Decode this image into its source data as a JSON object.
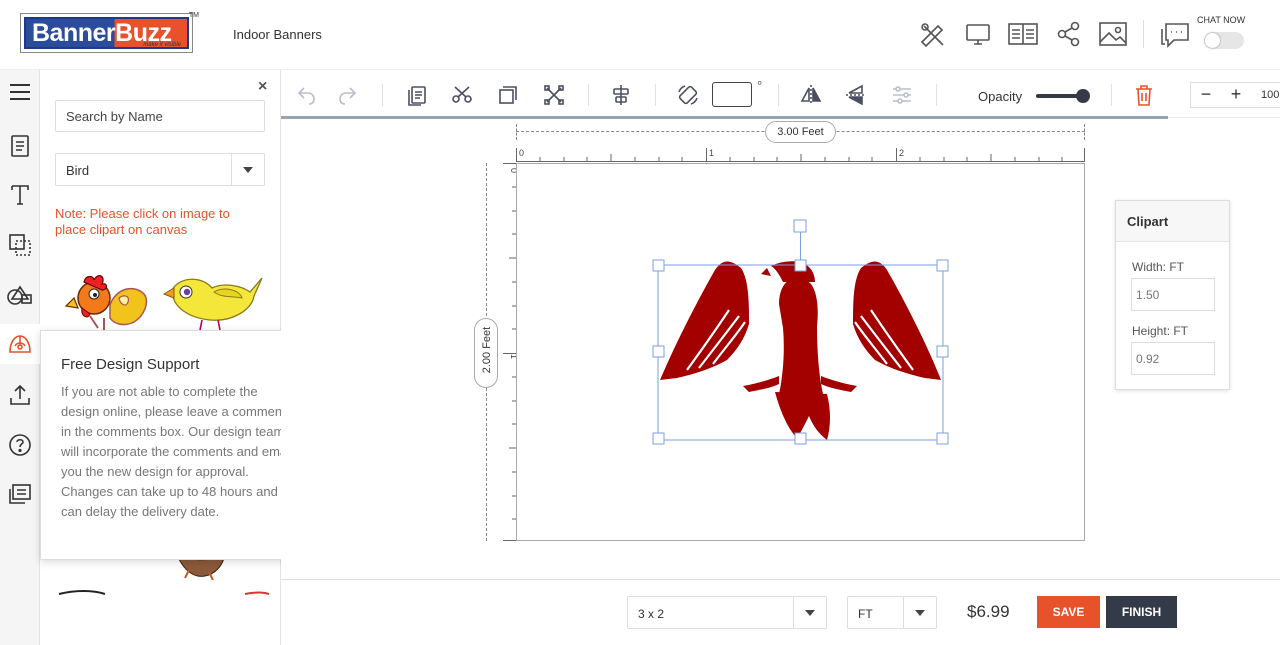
{
  "header": {
    "logo_text_a": "Banner",
    "logo_text_b": "Buzz",
    "logo_tagline": "make it visible",
    "logo_tm": "TM",
    "product_name": "Indoor Banners",
    "chat_label": "CHAT NOW",
    "icons": [
      "tools-icon",
      "desktop-preview-icon",
      "book-guide-icon",
      "share-icon",
      "image-icon",
      "chat-icon"
    ]
  },
  "leftbar": {
    "items": [
      "menu-icon",
      "templates-icon",
      "text-icon",
      "layers-icon",
      "shapes-icon",
      "clipart-icon",
      "upload-icon",
      "help-icon",
      "comments-icon"
    ],
    "active_index": 5
  },
  "panel": {
    "search_placeholder": "Search by Name",
    "category_selected": "Bird",
    "note": "Note: Please click on image to place clipart on canvas",
    "close_glyph": "×"
  },
  "tooltip": {
    "title": "Free Design Support",
    "body": "If you are not able to complete the design online, please leave a comments in the comments box. Our design team will incorporate the comments and email you the new design for approval. Changes can take up to 48 hours and can delay the delivery date.",
    "close_glyph": "×"
  },
  "toolbar": {
    "angle_value": "",
    "degree_symbol": "°",
    "opacity_label": "Opacity",
    "opacity_value": 1.0,
    "zoom_minus": "−",
    "zoom_plus": "+",
    "zoom_value": "100"
  },
  "canvas": {
    "width_label": "3.00 Feet",
    "height_label": "2.00 Feet",
    "ruler_h_labels": [
      "0",
      "1",
      "2"
    ],
    "ruler_v_labels": [
      "0",
      "1"
    ]
  },
  "props": {
    "title": "Clipart",
    "width_label": "Width: FT",
    "width_value": "1.50",
    "height_label": "Height: FT",
    "height_value": "0.92"
  },
  "footer": {
    "size_selected": "3 x 2",
    "unit_selected": "FT",
    "price": "$6.99",
    "save_label": "SAVE",
    "finish_label": "FINISH"
  },
  "colors": {
    "brand_blue": "#2b4b9b",
    "brand_orange": "#e8522b",
    "dark": "#333a48",
    "eagle_red": "#a30000",
    "selection": "#7b9fe0"
  }
}
